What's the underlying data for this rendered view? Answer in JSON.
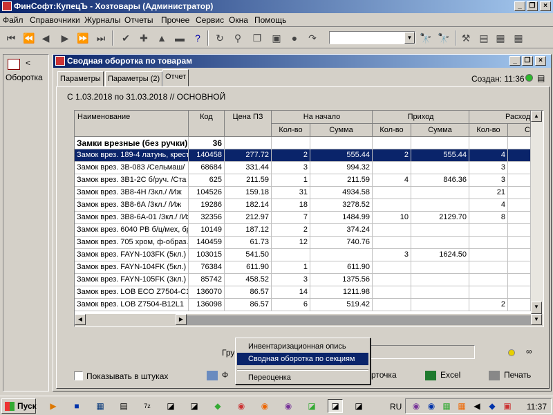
{
  "app": {
    "title": "ФинСофт:КупецЪ - Хозтовары  (Администратор)",
    "min": "_",
    "restore": "❐",
    "close": "×"
  },
  "menu": [
    "Файл",
    "Справочники",
    "Журналы",
    "Отчеты",
    "Прочее",
    "Сервис",
    "Окна",
    "Помощь"
  ],
  "left_panel": {
    "arrow": "<",
    "label": "Оборотка"
  },
  "window": {
    "title": "Сводная оборотка по товарам",
    "tabs": [
      "Параметры",
      "Параметры (2)",
      "Отчет"
    ],
    "active_tab": 2,
    "created": "Создан: 11:36",
    "period": "С  1.03.2018 по 31.03.2018 // ОСНОВНОЙ"
  },
  "grid": {
    "headers": {
      "name": "Наименование",
      "code": "Код",
      "price": "Цена ПЗ",
      "start": "На начало",
      "income": "Приход",
      "outcome": "Расход",
      "qty": "Кол-во",
      "sum": "Сумма",
      "sum_partial": "Сумма"
    },
    "group_row": {
      "name": "Замки врезные (без ручки)",
      "code": "36"
    },
    "rows": [
      {
        "name": "Замок врез. 189-4 латунь, крест",
        "code": "140458",
        "price": "277.72",
        "sq": "2",
        "ss": "555.44",
        "iq": "2",
        "is": "555.44",
        "oq": "4"
      },
      {
        "name": "Замок врез. 3В-083 /Сельмаш/",
        "code": "68684",
        "price": "331.44",
        "sq": "3",
        "ss": "994.32",
        "iq": "",
        "is": "",
        "oq": "3"
      },
      {
        "name": "Замок врез. 3В1-2С б/руч. /Ста",
        "code": "625",
        "price": "211.59",
        "sq": "1",
        "ss": "211.59",
        "iq": "4",
        "is": "846.36",
        "oq": "3"
      },
      {
        "name": "Замок врез. 3В8-4Н /3кл./  /Иж",
        "code": "104526",
        "price": "159.18",
        "sq": "31",
        "ss": "4934.58",
        "iq": "",
        "is": "",
        "oq": "21"
      },
      {
        "name": "Замок врез. 3В8-6А /3кл./  /Иж",
        "code": "19286",
        "price": "182.14",
        "sq": "18",
        "ss": "3278.52",
        "iq": "",
        "is": "",
        "oq": "4"
      },
      {
        "name": "Замок врез. 3В8-6А-01 /3кл./ /Иж",
        "code": "32356",
        "price": "212.97",
        "sq": "7",
        "ss": "1484.99",
        "iq": "10",
        "is": "2129.70",
        "oq": "8"
      },
      {
        "name": "Замок врез. 6040 PB б/ц/мех, бр",
        "code": "10149",
        "price": "187.12",
        "sq": "2",
        "ss": "374.24",
        "iq": "",
        "is": "",
        "oq": ""
      },
      {
        "name": "Замок врез. 705 хром, ф-образ.",
        "code": "140459",
        "price": "61.73",
        "sq": "12",
        "ss": "740.76",
        "iq": "",
        "is": "",
        "oq": ""
      },
      {
        "name": "Замок врез. FAYN-103FK (5кл.)",
        "code": "103015",
        "price": "541.50",
        "sq": "",
        "ss": "",
        "iq": "3",
        "is": "1624.50",
        "oq": ""
      },
      {
        "name": "Замок врез. FAYN-104FK (5кл.)",
        "code": "76384",
        "price": "611.90",
        "sq": "1",
        "ss": "611.90",
        "iq": "",
        "is": "",
        "oq": ""
      },
      {
        "name": "Замок врез. FAYN-105FK (3кл.)",
        "code": "85742",
        "price": "458.52",
        "sq": "3",
        "ss": "1375.56",
        "iq": "",
        "is": "",
        "oq": ""
      },
      {
        "name": "Замок врез. LOB ECO Z7504-C1",
        "code": "136070",
        "price": "86.57",
        "sq": "14",
        "ss": "1211.98",
        "iq": "",
        "is": "",
        "oq": ""
      },
      {
        "name": "Замок врез. LOB Z7504-B12L1",
        "code": "136098",
        "price": "86.57",
        "sq": "6",
        "ss": "519.42",
        "iq": "",
        "is": "",
        "oq": "2"
      }
    ]
  },
  "bottom": {
    "group_label": "Гру",
    "show_pieces": "Показывать в штуках",
    "form_label": "Ф",
    "card_label": "рточка",
    "excel": "Excel",
    "print": "Печать"
  },
  "popup": {
    "items": [
      "Инвентаризационная опись",
      "Сводная оборотка по секциям",
      "Переоценка"
    ],
    "highlighted": 1
  },
  "taskbar": {
    "start": "Пуск",
    "lang": "RU",
    "clock": "11:37"
  },
  "colors": {
    "titlebar": "#0a246a",
    "selection": "#0a246a",
    "face": "#d4d0c8"
  }
}
